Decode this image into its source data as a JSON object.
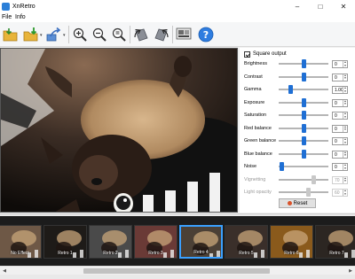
{
  "window": {
    "title": "XnRetro"
  },
  "menu": [
    {
      "label": "File"
    },
    {
      "label": "Info"
    }
  ],
  "toolbar": {
    "buttons": [
      {
        "name": "open-folder-icon"
      },
      {
        "name": "save-icon"
      },
      {
        "name": "export-icon"
      },
      {
        "name": "zoom-in-icon"
      },
      {
        "name": "zoom-out-icon"
      },
      {
        "name": "zoom-fit-icon"
      },
      {
        "name": "rotate-left-icon"
      },
      {
        "name": "rotate-right-icon"
      },
      {
        "name": "compare-icon"
      },
      {
        "name": "help-icon"
      }
    ]
  },
  "panel": {
    "square_output": "Square output",
    "sliders": [
      {
        "label": "Brightness",
        "value": "0",
        "level": 0.5,
        "enabled": true
      },
      {
        "label": "Contrast",
        "value": "0",
        "level": 0.5,
        "enabled": true
      },
      {
        "label": "Gamma",
        "value": "1.00",
        "level": 0.22,
        "enabled": true
      },
      {
        "label": "Exposure",
        "value": "0",
        "level": 0.5,
        "enabled": true
      },
      {
        "label": "Saturation",
        "value": "0",
        "level": 0.5,
        "enabled": true
      },
      {
        "label": "Red balance",
        "value": "0",
        "level": 0.5,
        "enabled": true
      },
      {
        "label": "Green balance",
        "value": "0",
        "level": 0.5,
        "enabled": true
      },
      {
        "label": "Blue balance",
        "value": "0",
        "level": 0.5,
        "enabled": true
      },
      {
        "label": "Noise",
        "value": "0",
        "level": 0.03,
        "enabled": true
      },
      {
        "label": "Vignetting",
        "value": "70",
        "level": 0.7,
        "enabled": false
      },
      {
        "label": "Light opacity",
        "value": "60",
        "level": 0.6,
        "enabled": false
      }
    ],
    "reset_label": "Reset"
  },
  "effects": [
    {
      "label": "No Effect",
      "tone": "#6e5846",
      "selected": false
    },
    {
      "label": "Retro 1",
      "tone": "#1e1b18",
      "selected": false
    },
    {
      "label": "Retro 2",
      "tone": "#4a4a4a",
      "selected": false
    },
    {
      "label": "Retro 3",
      "tone": "#6a3a36",
      "selected": false
    },
    {
      "label": "Retro 4",
      "tone": "#4b4036",
      "selected": true
    },
    {
      "label": "Retro 5",
      "tone": "#3a2f2a",
      "selected": false
    },
    {
      "label": "Retro 6",
      "tone": "#8a5a1c",
      "selected": false
    },
    {
      "label": "Retro 7",
      "tone": "#2c2622",
      "selected": false
    }
  ]
}
